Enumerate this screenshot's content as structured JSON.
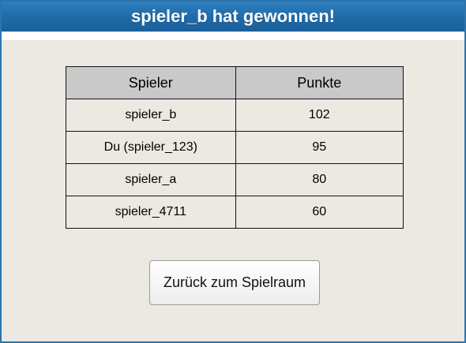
{
  "dialog": {
    "title": "spieler_b hat gewonnen!"
  },
  "scoreboard": {
    "headers": {
      "player": "Spieler",
      "points": "Punkte"
    },
    "rows": [
      {
        "player": "spieler_b",
        "points": "102"
      },
      {
        "player": "Du (spieler_123)",
        "points": "95"
      },
      {
        "player": "spieler_a",
        "points": "80"
      },
      {
        "player": "spieler_4711",
        "points": "60"
      }
    ]
  },
  "actions": {
    "back_label": "Zurück zum Spielraum"
  },
  "colors": {
    "title_bar": "#1f6aa8",
    "background": "#ece9e3",
    "header_row": "#c9c9c9"
  }
}
